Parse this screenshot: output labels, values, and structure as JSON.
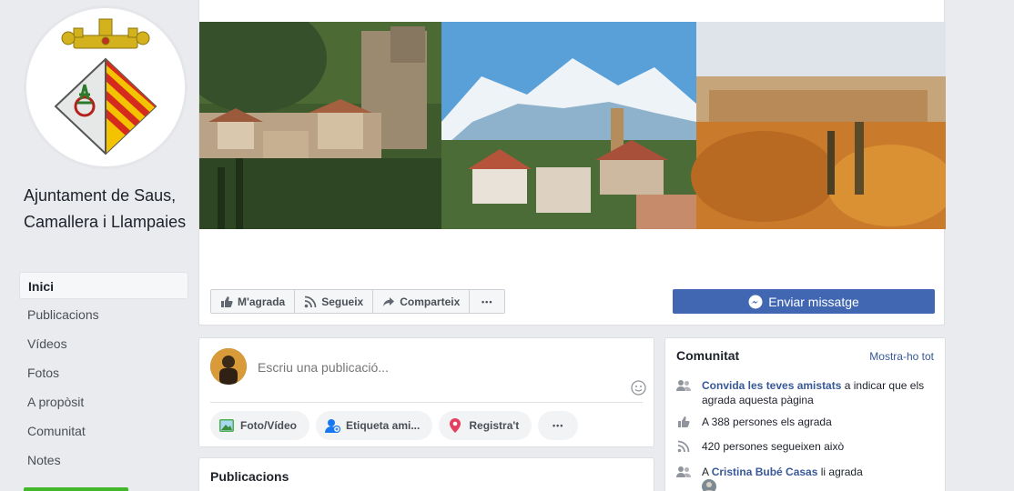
{
  "page": {
    "name": "Ajuntament de Saus, Camallera i Llampaies"
  },
  "nav": {
    "items": [
      "Inici",
      "Publicacions",
      "Vídeos",
      "Fotos",
      "A propòsit",
      "Comunitat",
      "Notes"
    ]
  },
  "actions": {
    "like": "M'agrada",
    "follow": "Segueix",
    "share": "Comparteix",
    "more": "•••",
    "message": "Enviar missatge"
  },
  "composer": {
    "placeholder": "Escriu una publicació...",
    "photo": "Foto/Vídeo",
    "tag": "Etiqueta ami...",
    "checkin": "Registra't",
    "more": "•••"
  },
  "publications": {
    "title": "Publicacions"
  },
  "community": {
    "title": "Comunitat",
    "see_all": "Mostra-ho tot",
    "invite_link": "Convida les teves amistats",
    "invite_rest": " a indicar que els agrada aquesta pàgina",
    "likes": "A 388 persones els agrada",
    "follows": "420 persones segueixen això",
    "friend_prefix": "A ",
    "friend_name": "Cristina Bubé Casas",
    "friend_suffix": " li agrada"
  },
  "colors": {
    "brand": "#4267b2",
    "link": "#385898",
    "background": "#e9ebee"
  }
}
